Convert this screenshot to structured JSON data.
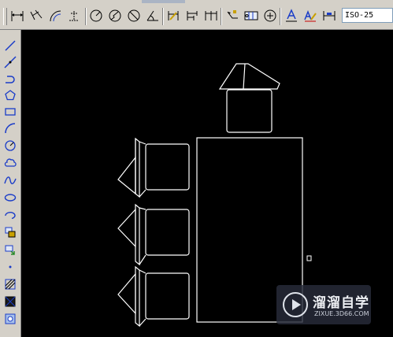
{
  "toolbar": {
    "dim_style_value": "ISO-25",
    "buttons": [
      {
        "name": "linear-dimension",
        "icon": "linear-dimension-icon"
      },
      {
        "name": "aligned-dimension",
        "icon": "aligned-dimension-icon"
      },
      {
        "name": "arc-length",
        "icon": "arc-length-icon"
      },
      {
        "name": "ordinate-dimension",
        "icon": "ordinate-dimension-icon"
      },
      {
        "name": "radius-dimension",
        "icon": "radius-dimension-icon"
      },
      {
        "name": "jogged-dimension",
        "icon": "jogged-dimension-icon"
      },
      {
        "name": "diameter-dimension",
        "icon": "diameter-dimension-icon"
      },
      {
        "name": "angular-dimension",
        "icon": "angular-dimension-icon"
      },
      {
        "name": "quick-dimension",
        "icon": "quick-dimension-icon"
      },
      {
        "name": "baseline-dimension",
        "icon": "baseline-dimension-icon"
      },
      {
        "name": "continue-dimension",
        "icon": "continue-dimension-icon"
      },
      {
        "name": "quick-leader",
        "icon": "quick-leader-icon"
      },
      {
        "name": "tolerance",
        "icon": "tolerance-icon"
      },
      {
        "name": "center-mark",
        "icon": "center-mark-icon"
      },
      {
        "name": "dimension-edit",
        "icon": "dimension-edit-icon"
      },
      {
        "name": "dimension-text-edit",
        "icon": "dimension-text-edit-icon"
      },
      {
        "name": "dimension-update",
        "icon": "dimension-update-icon"
      }
    ]
  },
  "sidebar": {
    "tools": [
      {
        "name": "line",
        "icon": "line-icon"
      },
      {
        "name": "construction-line",
        "icon": "construction-line-icon"
      },
      {
        "name": "polyline",
        "icon": "polyline-icon"
      },
      {
        "name": "polygon",
        "icon": "polygon-icon"
      },
      {
        "name": "rectangle",
        "icon": "rectangle-icon"
      },
      {
        "name": "arc",
        "icon": "arc-icon"
      },
      {
        "name": "circle",
        "icon": "circle-icon"
      },
      {
        "name": "revision-cloud",
        "icon": "revision-cloud-icon"
      },
      {
        "name": "spline",
        "icon": "spline-icon"
      },
      {
        "name": "ellipse",
        "icon": "ellipse-icon"
      },
      {
        "name": "ellipse-arc",
        "icon": "ellipse-arc-icon"
      },
      {
        "name": "insert-block",
        "icon": "insert-block-icon"
      },
      {
        "name": "make-block",
        "icon": "make-block-icon"
      },
      {
        "name": "point",
        "icon": "point-icon"
      },
      {
        "name": "hatch",
        "icon": "hatch-icon"
      },
      {
        "name": "gradient",
        "icon": "gradient-icon"
      },
      {
        "name": "region",
        "icon": "region-icon"
      }
    ]
  },
  "colors": {
    "canvas_background": "#000000",
    "drawing_lines": "#ffffff",
    "toolbar_background": "#d4d0c8"
  },
  "watermark": {
    "title": "溜溜自学",
    "subtitle": "ZIXUE.3D66.COM"
  }
}
